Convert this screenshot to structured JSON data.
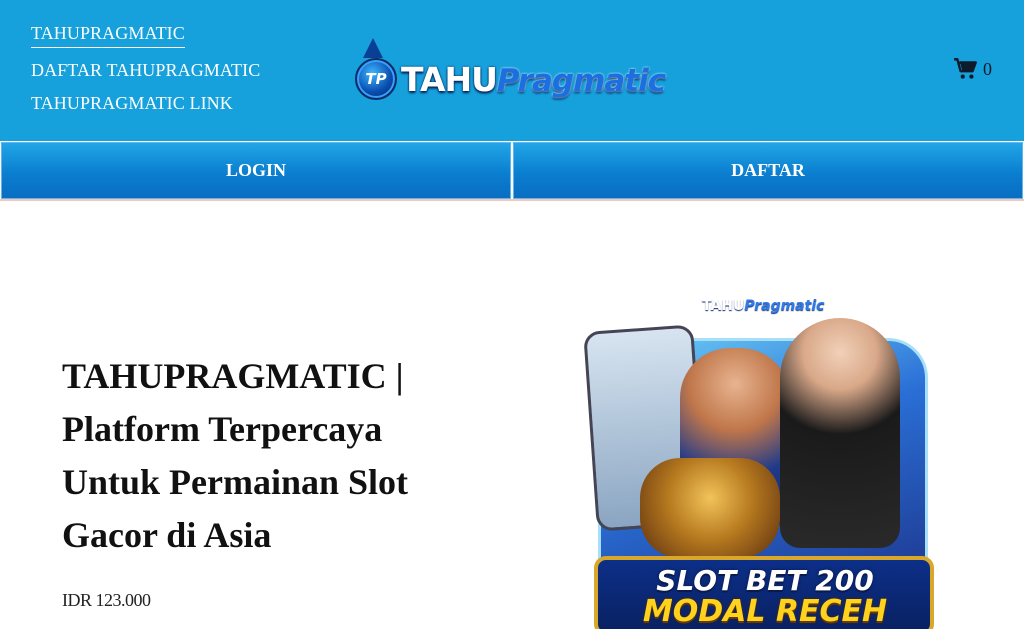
{
  "nav": {
    "items": [
      {
        "label": "TAHUPRAGMATIC"
      },
      {
        "label": "DAFTAR TAHUPRAGMATIC"
      },
      {
        "label": "TAHUPRAGMATIC LINK"
      }
    ]
  },
  "logo": {
    "badge": "TP",
    "text_main": "TAHU",
    "text_accent": "Pragmatic"
  },
  "cart": {
    "icon": "cart-icon",
    "count": "0"
  },
  "auth": {
    "login_label": "LOGIN",
    "register_label": "DAFTAR"
  },
  "main": {
    "title": "TAHUPRAGMATIC | Platform Terpercaya Untuk Permainan Slot Gacor di Asia",
    "price": "IDR 123.000"
  },
  "banner": {
    "logo_main": "TAHU",
    "logo_accent": "Pragmatic",
    "line1": "SLOT BET 200",
    "line2": "MODAL RECEH"
  },
  "colors": {
    "header_bg": "#16a1dc",
    "button_bg": "#0b7ed0",
    "text": "#111111"
  }
}
